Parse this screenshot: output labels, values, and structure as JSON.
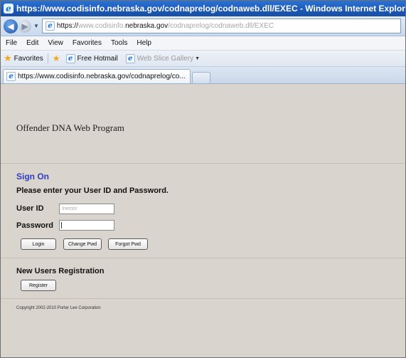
{
  "window": {
    "title": "https://www.codisinfo.nebraska.gov/codnaprelog/codnaweb.dll/EXEC - Windows Internet Explorer"
  },
  "address": {
    "scheme": "https://",
    "prefix": "www.codisinfo.",
    "host": "nebraska.gov",
    "path": "/codnaprelog/codnaweb.dll/EXEC"
  },
  "menu": {
    "items": [
      "File",
      "Edit",
      "View",
      "Favorites",
      "Tools",
      "Help"
    ]
  },
  "favorites": {
    "label": "Favorites",
    "items": [
      "Free Hotmail",
      "Web Slice Gallery"
    ]
  },
  "tabs": {
    "active": "https://www.codisinfo.nebraska.gov/codnaprelog/co..."
  },
  "page": {
    "title": "Offender DNA Web Program",
    "signon_heading": "Sign On",
    "instructions": "Please enter your User ID and Password.",
    "userid_label": "User ID",
    "userid_value": "Inector",
    "password_label": "Password",
    "password_value": "",
    "login_button": "Login",
    "change_pwd_button": "Change Pwd",
    "forgot_pwd_button": "Forgot Pwd",
    "new_users_heading": "New Users Registration",
    "register_button": "Register",
    "copyright": "Copyright 2002-2010 Porter Lee Corporation"
  },
  "colors": {
    "title_bar": "#1d58b4",
    "page_background": "#d9d4cd",
    "heading_accent": "#2f3ec4"
  }
}
